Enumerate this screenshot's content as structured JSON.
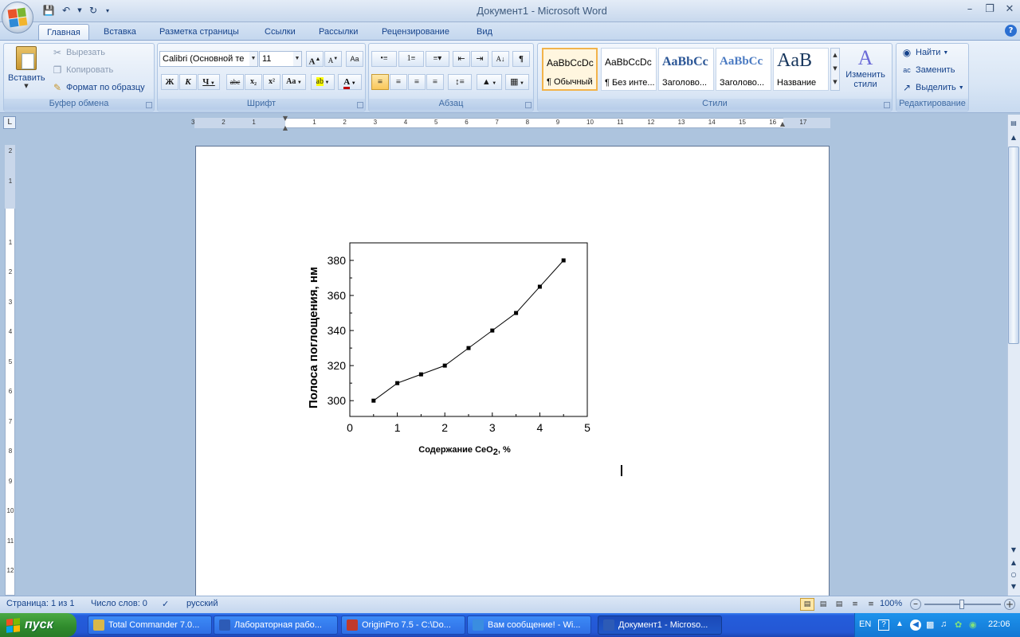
{
  "window": {
    "title": "Документ1 - Microsoft Word"
  },
  "tabs": [
    "Главная",
    "Вставка",
    "Разметка страницы",
    "Ссылки",
    "Рассылки",
    "Рецензирование",
    "Вид"
  ],
  "clipboard": {
    "paste": "Вставить",
    "cut": "Вырезать",
    "copy": "Копировать",
    "format_painter": "Формат по образцу",
    "label": "Буфер обмена"
  },
  "font": {
    "name": "Calibri (Основной те",
    "size": "11",
    "bold": "Ж",
    "italic": "К",
    "underline": "Ч",
    "strike": "abc",
    "sub": "x₂",
    "sup": "x²",
    "case": "Aa",
    "grow": "A",
    "shrink": "A",
    "highlight": "ab",
    "color": "A",
    "label": "Шрифт"
  },
  "paragraph": {
    "label": "Абзац",
    "pilcrow": "¶"
  },
  "styles": {
    "label": "Стили",
    "items": [
      {
        "sample": "AaBbCcDc",
        "name": "¶ Обычный"
      },
      {
        "sample": "AaBbCcDc",
        "name": "¶ Без инте..."
      },
      {
        "sample": "AaBbCc",
        "name": "Заголово..."
      },
      {
        "sample": "AaBbCc",
        "name": "Заголово..."
      },
      {
        "sample": "AaB",
        "name": "Название"
      }
    ],
    "change": "Изменить стили"
  },
  "editing": {
    "label": "Редактирование",
    "find": "Найти",
    "replace": "Заменить",
    "select": "Выделить"
  },
  "ruler": {
    "h_numbers": [
      "3",
      "2",
      "1",
      "1",
      "2",
      "3",
      "4",
      "5",
      "6",
      "7",
      "8",
      "9",
      "10",
      "11",
      "12",
      "13",
      "14",
      "15",
      "16",
      "17"
    ],
    "v_numbers": [
      "2",
      "1",
      "1",
      "2",
      "3",
      "4",
      "5",
      "6",
      "7",
      "8",
      "9",
      "10",
      "11",
      "12"
    ]
  },
  "status": {
    "page": "Страница: 1 из 1",
    "words": "Число слов: 0",
    "lang": "русский",
    "zoom": "100%"
  },
  "taskbar": {
    "start": "пуск",
    "tasks": [
      {
        "label": "Total Commander 7.0...",
        "color": "#d9b84a"
      },
      {
        "label": "Лабораторная рабо...",
        "color": "#2d5bb6"
      },
      {
        "label": "OriginPro 7.5 - C:\\Do...",
        "color": "#c03a2b"
      },
      {
        "label": "Вам сообщение! - Wi...",
        "color": "#3a8de0"
      },
      {
        "label": "Документ1 - Microso...",
        "color": "#2d5bb6"
      }
    ],
    "lang": "EN",
    "time": "22:06"
  },
  "chart_data": {
    "type": "line",
    "x": [
      0.5,
      1.0,
      1.5,
      2.0,
      2.5,
      3.0,
      3.5,
      4.0,
      4.5
    ],
    "series": [
      {
        "values": [
          300,
          310,
          315,
          320,
          330,
          340,
          350,
          365,
          380
        ]
      }
    ],
    "xlabel": "Содержание CeO",
    "xlabel_sub": "2",
    "xlabel_suffix": ", %",
    "ylabel": "Полоса поглощения, нм",
    "xlim": [
      0,
      5
    ],
    "ylim": [
      291,
      390
    ],
    "xticks": [
      "0",
      "1",
      "2",
      "3",
      "4",
      "5"
    ],
    "yticks": [
      "300",
      "320",
      "340",
      "360",
      "380"
    ],
    "marker": "square",
    "grid": false
  }
}
